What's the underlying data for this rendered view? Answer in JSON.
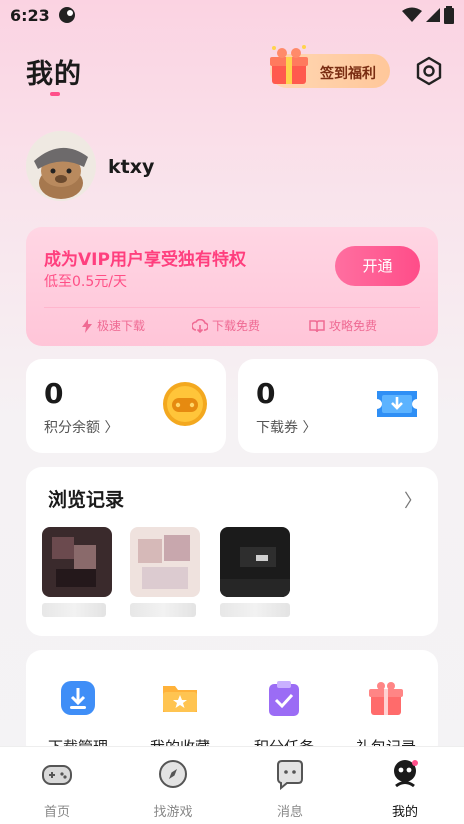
{
  "status_bar": {
    "time": "6:23"
  },
  "header": {
    "title": "我的",
    "signin_label": "签到福利"
  },
  "profile": {
    "username": "ktxy"
  },
  "vip": {
    "title": "成为VIP用户享受独有特权",
    "subtitle": "低至0.5元/天",
    "open_label": "开通",
    "benefits": [
      "极速下载",
      "下载免费",
      "攻略免费"
    ]
  },
  "stats": {
    "points": {
      "value": "0",
      "label": "积分余额 〉"
    },
    "coupons": {
      "value": "0",
      "label": "下载券 〉"
    }
  },
  "history": {
    "title": "浏览记录",
    "arrow": "〉"
  },
  "tools": [
    {
      "label": "下载管理",
      "icon": "download-manager-icon"
    },
    {
      "label": "我的收藏",
      "icon": "favorites-folder-icon"
    },
    {
      "label": "积分任务",
      "icon": "task-clipboard-icon"
    },
    {
      "label": "礼包记录",
      "icon": "gift-box-icon"
    }
  ],
  "nav": [
    {
      "label": "首页",
      "icon": "gamepad-icon"
    },
    {
      "label": "找游戏",
      "icon": "compass-icon"
    },
    {
      "label": "消息",
      "icon": "message-icon"
    },
    {
      "label": "我的",
      "icon": "profile-icon"
    }
  ],
  "colors": {
    "accent": "#ff4f8a",
    "vip_text": "#ff3f7e"
  }
}
